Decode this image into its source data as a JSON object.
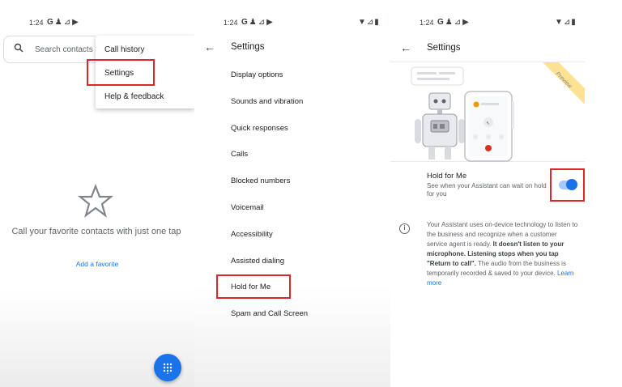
{
  "status": {
    "time": "1:24",
    "icons": [
      "google-g-icon",
      "person-icon",
      "signal-icon",
      "play-icon"
    ],
    "right_icons": [
      "wifi-icon",
      "signal-icon",
      "battery-icon"
    ]
  },
  "favorites": {
    "search_placeholder": "Search contacts &",
    "menu": {
      "call_history": "Call history",
      "settings": "Settings",
      "help_feedback": "Help & feedback"
    },
    "empty_text": "Call your favorite contacts with just one tap",
    "add_favorite": "Add a favorite"
  },
  "settings": {
    "title": "Settings",
    "items": [
      "Display options",
      "Sounds and vibration",
      "Quick responses",
      "Calls",
      "Blocked numbers",
      "Voicemail",
      "Accessibility",
      "Assisted dialing",
      "Hold for Me",
      "Spam and Call Screen"
    ]
  },
  "hold_for_me": {
    "title": "Settings",
    "preview_badge": "Preview",
    "option_title": "Hold for Me",
    "option_subtitle": "See when your Assistant can wait on hold for you",
    "toggle_on": true,
    "info": {
      "part1": "Your Assistant uses on-device technology to listen to the business and recognize when a customer service agent is ready. ",
      "bold1": "It doesn't listen to your microphone. Listening stops when you tap \"Return to call\".",
      "part2": " The audio from the business is temporarily recorded & saved to your device. ",
      "link": "Learn more"
    }
  },
  "colors": {
    "accent": "#1a73e8",
    "highlight_box": "#e0242b"
  }
}
